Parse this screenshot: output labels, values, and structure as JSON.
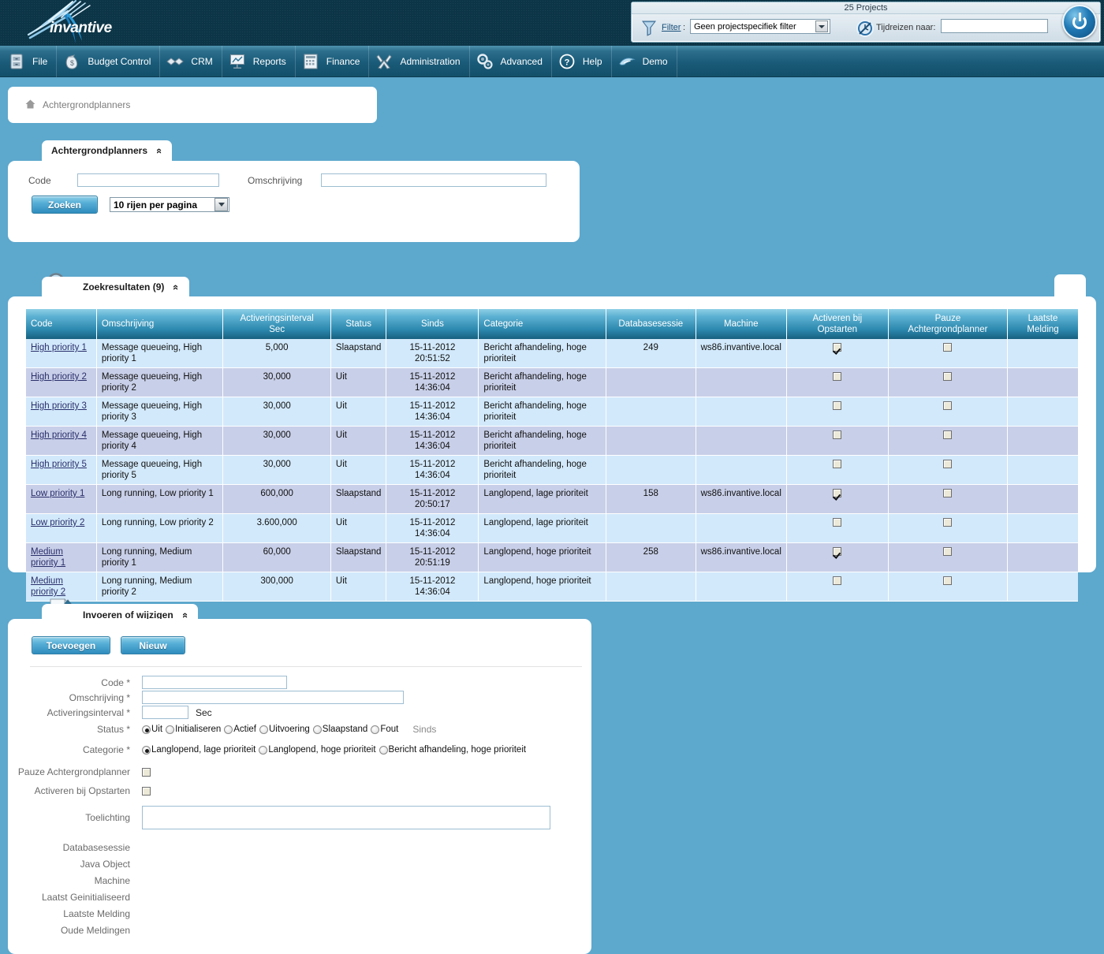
{
  "app": {
    "brand": "invantive",
    "logo_icon": "invantive-burst-logo"
  },
  "filter_box": {
    "title": "25 Projects",
    "funnel_icon": "funnel-icon",
    "filter_label": "Filter",
    "colon": ":",
    "filter_value": "Geen projectspecifiek filter",
    "clock_icon": "time-travel-clock-icon",
    "timetravel_label": "Tijdreizen naar:",
    "timetravel_value": "",
    "power_icon": "power-logout-icon"
  },
  "menu": {
    "items": [
      {
        "label": "File",
        "icon": "file-cabinet-icon"
      },
      {
        "label": "Budget Control",
        "icon": "money-bag-icon"
      },
      {
        "label": "CRM",
        "icon": "handshake-icon"
      },
      {
        "label": "Reports",
        "icon": "presentation-chart-icon"
      },
      {
        "label": "Finance",
        "icon": "calculator-icon"
      },
      {
        "label": "Administration",
        "icon": "wrench-screwdriver-icon"
      },
      {
        "label": "Advanced",
        "icon": "gears-icon"
      },
      {
        "label": "Help",
        "icon": "question-mark-icon"
      },
      {
        "label": "Demo",
        "icon": "dolphin-icon"
      }
    ]
  },
  "breadcrumb": {
    "home_icon": "home-icon",
    "text": "Achtergrondplanners"
  },
  "search_panel": {
    "tab_label": "Achtergrondplanners",
    "collapse_icon": "chevron-up-icon",
    "code_label": "Code",
    "code_value": "",
    "omschrijving_label": "Omschrijving",
    "omschrijving_value": "",
    "search_button": "Zoeken",
    "rows_per_page": "10 rijen per pagina"
  },
  "results_panel": {
    "tab_label": "Zoekresultaten (9)",
    "tab_icon": "magnifier-icon",
    "collapse_icon": "chevron-up-icon",
    "columns": [
      "Code",
      "Omschrijving",
      "Activeringsinterval Sec",
      "Status",
      "Sinds",
      "Categorie",
      "Databasesessie",
      "Machine",
      "Activeren bij Opstarten",
      "Pauze Achtergrondplanner",
      "Laatste Melding"
    ],
    "columns_wrapped": [
      [
        "Code"
      ],
      [
        "Omschrijving"
      ],
      [
        "Activeringsinterval",
        "Sec"
      ],
      [
        "Status"
      ],
      [
        "Sinds"
      ],
      [
        "Categorie"
      ],
      [
        "Databasesessie"
      ],
      [
        "Machine"
      ],
      [
        "Activeren bij",
        "Opstarten"
      ],
      [
        "Pauze",
        "Achtergrondplanner"
      ],
      [
        "Laatste",
        "Melding"
      ]
    ],
    "rows": [
      {
        "code": "High priority 1",
        "omschrijving": "Message queueing, High priority 1",
        "interval": "5,000",
        "status": "Slaapstand",
        "sinds": "15-11-2012 20:51:52",
        "categorie": "Bericht afhandeling, hoge prioriteit",
        "databasesessie": "249",
        "machine": "ws86.invantive.local",
        "activeren": true,
        "pauze": false,
        "laatste_melding": ""
      },
      {
        "code": "High priority 2",
        "omschrijving": "Message queueing, High priority 2",
        "interval": "30,000",
        "status": "Uit",
        "sinds": "15-11-2012 14:36:04",
        "categorie": "Bericht afhandeling, hoge prioriteit",
        "databasesessie": "",
        "machine": "",
        "activeren": false,
        "pauze": false,
        "laatste_melding": ""
      },
      {
        "code": "High priority 3",
        "omschrijving": "Message queueing, High priority 3",
        "interval": "30,000",
        "status": "Uit",
        "sinds": "15-11-2012 14:36:04",
        "categorie": "Bericht afhandeling, hoge prioriteit",
        "databasesessie": "",
        "machine": "",
        "activeren": false,
        "pauze": false,
        "laatste_melding": ""
      },
      {
        "code": "High priority 4",
        "omschrijving": "Message queueing, High priority 4",
        "interval": "30,000",
        "status": "Uit",
        "sinds": "15-11-2012 14:36:04",
        "categorie": "Bericht afhandeling, hoge prioriteit",
        "databasesessie": "",
        "machine": "",
        "activeren": false,
        "pauze": false,
        "laatste_melding": ""
      },
      {
        "code": "High priority 5",
        "omschrijving": "Message queueing, High priority 5",
        "interval": "30,000",
        "status": "Uit",
        "sinds": "15-11-2012 14:36:04",
        "categorie": "Bericht afhandeling, hoge prioriteit",
        "databasesessie": "",
        "machine": "",
        "activeren": false,
        "pauze": false,
        "laatste_melding": ""
      },
      {
        "code": "Low priority 1",
        "omschrijving": "Long running, Low priority 1",
        "interval": "600,000",
        "status": "Slaapstand",
        "sinds": "15-11-2012 20:50:17",
        "categorie": "Langlopend, lage prioriteit",
        "databasesessie": "158",
        "machine": "ws86.invantive.local",
        "activeren": true,
        "pauze": false,
        "laatste_melding": ""
      },
      {
        "code": "Low priority 2",
        "omschrijving": "Long running, Low priority 2",
        "interval": "3.600,000",
        "status": "Uit",
        "sinds": "15-11-2012 14:36:04",
        "categorie": "Langlopend, lage prioriteit",
        "databasesessie": "",
        "machine": "",
        "activeren": false,
        "pauze": false,
        "laatste_melding": ""
      },
      {
        "code": "Medium priority 1",
        "omschrijving": "Long running, Medium priority 1",
        "interval": "60,000",
        "status": "Slaapstand",
        "sinds": "15-11-2012 20:51:19",
        "categorie": "Langlopend, hoge prioriteit",
        "databasesessie": "258",
        "machine": "ws86.invantive.local",
        "activeren": true,
        "pauze": false,
        "laatste_melding": ""
      },
      {
        "code": "Medium priority 2",
        "omschrijving": "Long running, Medium priority 2",
        "interval": "300,000",
        "status": "Uit",
        "sinds": "15-11-2012 14:36:04",
        "categorie": "Langlopend, hoge prioriteit",
        "databasesessie": "",
        "machine": "",
        "activeren": false,
        "pauze": false,
        "laatste_melding": ""
      }
    ]
  },
  "edit_panel": {
    "tab_label": "Invoeren of wijzigen",
    "tab_icon": "pencil-document-icon",
    "collapse_icon": "chevron-up-icon",
    "add_button": "Toevoegen",
    "new_button": "Nieuw",
    "fields": {
      "code_label": "Code *",
      "code_value": "",
      "omschrijving_label": "Omschrijving *",
      "omschrijving_value": "",
      "interval_label": "Activeringsinterval *",
      "interval_value": "",
      "interval_unit": "Sec",
      "status_label": "Status *",
      "status_options": [
        "Uit",
        "Initialiseren",
        "Actief",
        "Uitvoering",
        "Slaapstand",
        "Fout"
      ],
      "status_selected": "Uit",
      "sinds_label": "Sinds",
      "categorie_label": "Categorie *",
      "categorie_options": [
        "Langlopend, lage prioriteit",
        "Langlopend, hoge prioriteit",
        "Bericht afhandeling, hoge prioriteit"
      ],
      "categorie_selected": "Langlopend, lage prioriteit",
      "pauze_label": "Pauze Achtergrondplanner",
      "pauze_checked": false,
      "activeren_label": "Activeren bij Opstarten",
      "activeren_checked": false,
      "toelichting_label": "Toelichting",
      "toelichting_value": ""
    },
    "readonly_labels": [
      "Databasesessie",
      "Java Object",
      "Machine",
      "Laatst Geinitialiseerd",
      "Laatste Melding",
      "Oude Meldingen"
    ]
  },
  "colors": {
    "page_background": "#5da8cd",
    "banner": "#0c3547",
    "menubar": "#1a5b79",
    "header_gradient_top": "#8ecfe6",
    "header_gradient_bottom": "#17607f",
    "row_odd": "#d2e9fb",
    "row_even": "#c8cfe8",
    "link": "#2a2f6b",
    "button_accent": "#2e8cbd"
  }
}
